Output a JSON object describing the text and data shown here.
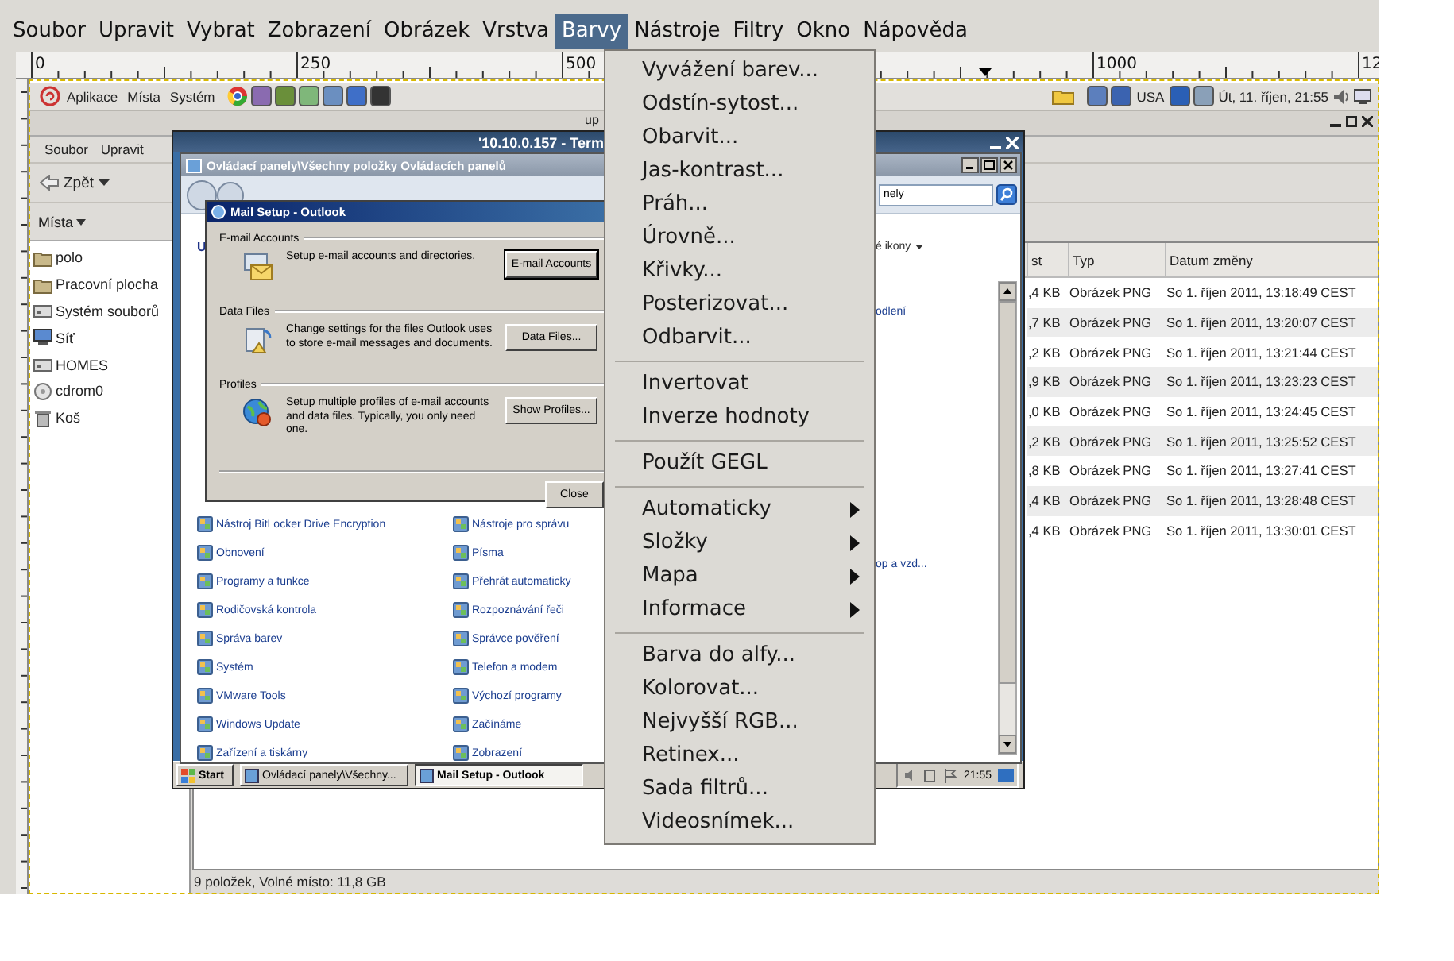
{
  "menubar": [
    {
      "label": "Soubor",
      "selected": false
    },
    {
      "label": "Upravit",
      "selected": false
    },
    {
      "label": "Vybrat",
      "selected": false
    },
    {
      "label": "Zobrazení",
      "selected": false
    },
    {
      "label": "Obrázek",
      "selected": false
    },
    {
      "label": "Vrstva",
      "selected": false
    },
    {
      "label": "Barvy",
      "selected": true
    },
    {
      "label": "Nástroje",
      "selected": false
    },
    {
      "label": "Filtry",
      "selected": false
    },
    {
      "label": "Okno",
      "selected": false
    },
    {
      "label": "Nápověda",
      "selected": false
    }
  ],
  "ruler": {
    "labels": [
      "0",
      "250",
      "500",
      "1000",
      "12"
    ]
  },
  "desktop_panel": {
    "menus": [
      "Aplikace",
      "Místa",
      "Systém"
    ],
    "keyboard_layout": "USA",
    "clock": "Út, 11. říjen, 21:55"
  },
  "file_manager": {
    "title": "up",
    "menus": [
      "Soubor",
      "Upravit"
    ],
    "back_button": "Zpět",
    "sidebar": {
      "title": "Místa",
      "items": [
        {
          "label": "polo",
          "kind": "folder"
        },
        {
          "label": "Pracovní plocha",
          "kind": "folder"
        },
        {
          "label": "Systém souborů",
          "kind": "drive"
        },
        {
          "label": "Síť",
          "kind": "network"
        },
        {
          "label": "HOMES",
          "kind": "drive"
        },
        {
          "label": "cdrom0",
          "kind": "disc"
        },
        {
          "label": "Koš",
          "kind": "trash"
        }
      ]
    },
    "table": {
      "columns": [
        "st",
        "Typ",
        "Datum změny"
      ],
      "rows": [
        [
          ",4 KB",
          "Obrázek PNG",
          "So 1. říjen 2011, 13:18:49 CEST"
        ],
        [
          ",7 KB",
          "Obrázek PNG",
          "So 1. říjen 2011, 13:20:07 CEST"
        ],
        [
          ",2 KB",
          "Obrázek PNG",
          "So 1. říjen 2011, 13:21:44 CEST"
        ],
        [
          ",9 KB",
          "Obrázek PNG",
          "So 1. říjen 2011, 13:23:23 CEST"
        ],
        [
          ",0 KB",
          "Obrázek PNG",
          "So 1. říjen 2011, 13:24:45 CEST"
        ],
        [
          ",2 KB",
          "Obrázek PNG",
          "So 1. říjen 2011, 13:25:52 CEST"
        ],
        [
          ",8 KB",
          "Obrázek PNG",
          "So 1. říjen 2011, 13:27:41 CEST"
        ],
        [
          ",4 KB",
          "Obrázek PNG",
          "So 1. říjen 2011, 13:28:48 CEST"
        ],
        [
          ",4 KB",
          "Obrázek PNG",
          "So 1. říjen 2011, 13:30:01 CEST"
        ]
      ]
    },
    "status_bar": "9 položek, Volné místo: 11,8 GB"
  },
  "remote_window": {
    "title": "'10.10.0.157 - Term",
    "control_panel": {
      "title": "Ovládací panely\\Všechny položky Ovládacích panelů",
      "search": "nely",
      "heading": "U",
      "view": "é ikony",
      "links": [
        "odlení",
        "op a vzd..."
      ],
      "items_left": [
        "Nástroj BitLocker Drive Encryption",
        "Obnovení",
        "Programy a funkce",
        "Rodičovská kontrola",
        "Správa barev",
        "Systém",
        "VMware Tools",
        "Windows Update",
        "Zařízení a tiskárny"
      ],
      "items_right": [
        "Nástroje pro správu",
        "Písma",
        "Přehrát automaticky",
        "Rozpoznávání řeči",
        "Správce pověření",
        "Telefon a modem",
        "Výchozí programy",
        "Začínáme",
        "Zobrazení"
      ]
    },
    "mail_setup": {
      "title": "Mail Setup - Outlook",
      "sections": [
        {
          "heading": "E-mail Accounts",
          "kind": "envelope",
          "text": "Setup e-mail accounts and directories.",
          "button": "E-mail Accounts"
        },
        {
          "heading": "Data Files",
          "kind": "document",
          "text": "Change settings for the files Outlook uses to store e-mail messages and documents.",
          "button": "Data Files..."
        },
        {
          "heading": "Profiles",
          "kind": "globe",
          "text": "Setup multiple profiles of e-mail accounts and data files. Typically, you only need one.",
          "button": "Show Profiles..."
        }
      ],
      "close_button": "Close"
    },
    "taskbar": {
      "start": "Start",
      "tasks": [
        {
          "label": "Ovládací panely\\Všechny...",
          "selected": false
        },
        {
          "label": "Mail Setup - Outlook",
          "selected": true
        }
      ],
      "clock": "21:55"
    }
  },
  "color_menu": {
    "items": [
      {
        "kind": "item",
        "label": "Vyvážení barev..."
      },
      {
        "kind": "item",
        "label": "Odstín-sytost..."
      },
      {
        "kind": "item",
        "label": "Obarvit..."
      },
      {
        "kind": "item",
        "label": "Jas-kontrast..."
      },
      {
        "kind": "item",
        "label": "Práh..."
      },
      {
        "kind": "item",
        "label": "Úrovně..."
      },
      {
        "kind": "item",
        "label": "Křivky..."
      },
      {
        "kind": "item",
        "label": "Posterizovat..."
      },
      {
        "kind": "item",
        "label": "Odbarvit..."
      },
      {
        "kind": "separator"
      },
      {
        "kind": "item",
        "label": "Invertovat"
      },
      {
        "kind": "item",
        "label": "Inverze hodnoty"
      },
      {
        "kind": "separator"
      },
      {
        "kind": "item",
        "label": "Použít GEGL"
      },
      {
        "kind": "separator"
      },
      {
        "kind": "submenu",
        "label": "Automaticky"
      },
      {
        "kind": "submenu",
        "label": "Složky"
      },
      {
        "kind": "submenu",
        "label": "Mapa"
      },
      {
        "kind": "submenu",
        "label": "Informace"
      },
      {
        "kind": "separator"
      },
      {
        "kind": "item",
        "label": "Barva do alfy..."
      },
      {
        "kind": "item",
        "label": "Kolorovat..."
      },
      {
        "kind": "item",
        "label": "Nejvyšší RGB..."
      },
      {
        "kind": "item",
        "label": "Retinex..."
      },
      {
        "kind": "item",
        "label": "Sada filtrů..."
      },
      {
        "kind": "item",
        "label": "Videosnímek..."
      }
    ]
  }
}
